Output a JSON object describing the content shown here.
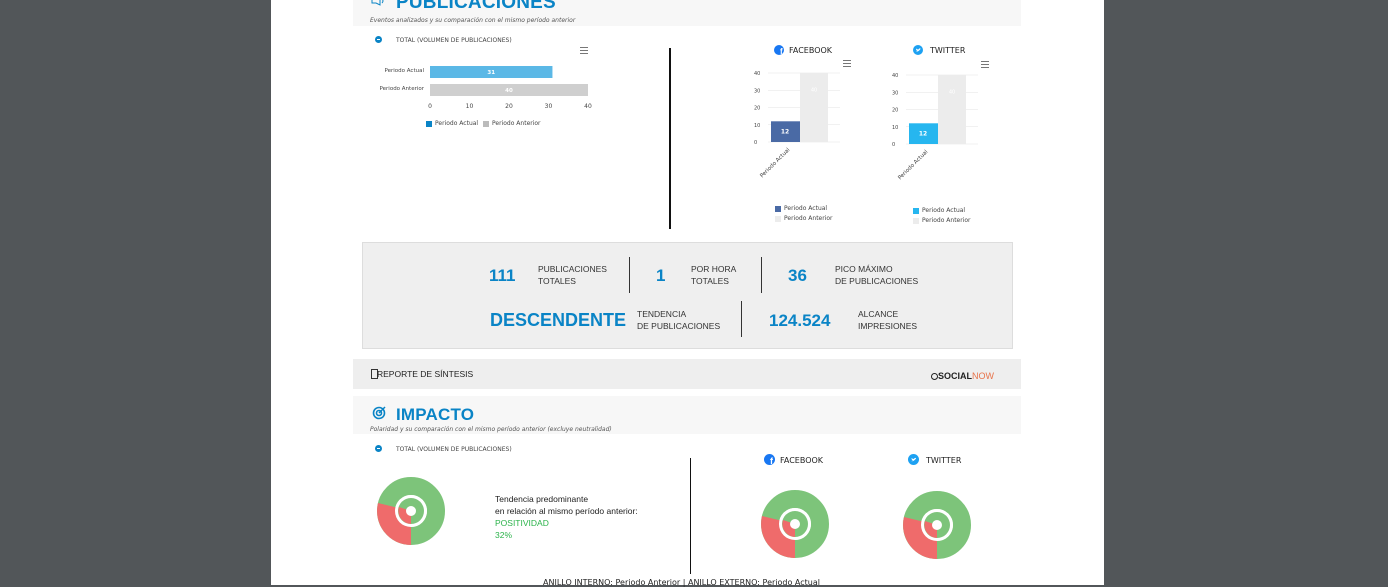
{
  "publicaciones": {
    "title": "PUBLICACIONES",
    "subtitle": "Eventos analizados y su comparación con el mismo período anterior",
    "total_label": "TOTAL (VOLUMEN DE PUBLICACIONES)",
    "facebook_label": "FACEBOOK",
    "twitter_label": "TWITTER",
    "legend_actual": "Periodo Actual",
    "legend_anterior": "Periodo Anterior"
  },
  "stats": {
    "publicaciones_totales": {
      "value": "111",
      "label1": "PUBLICACIONES",
      "label2": "TOTALES"
    },
    "por_hora": {
      "value": "1",
      "label1": "POR HORA",
      "label2": "TOTALES"
    },
    "pico": {
      "value": "36",
      "label1": "PICO MÁXIMO",
      "label2": "DE PUBLICACIONES"
    },
    "tendencia": {
      "value": "DESCENDENTE",
      "label1": "TENDENCIA",
      "label2": "DE PUBLICACIONES"
    },
    "alcance": {
      "value": "124.524",
      "label1": "ALCANCE",
      "label2": "IMPRESIONES"
    }
  },
  "footer": {
    "report_label": "REPORTE DE SÍNTESIS",
    "brand_bold": "SOCIAL",
    "brand_light": "NOW"
  },
  "impacto": {
    "title": "IMPACTO",
    "subtitle": "Polaridad y su comparación con el mismo período anterior (excluye neutralidad)",
    "total_label": "TOTAL (VOLUMEN DE PUBLICACIONES)",
    "facebook_label": "FACEBOOK",
    "twitter_label": "TWITTER",
    "trend_line1": "Tendencia predominante",
    "trend_line2": "en relación al mismo período anterior:",
    "trend_value": "POSITIVIDAD",
    "trend_pct": "32%",
    "bottom_caption": "ANILLO INTERNO: Periodo Anterior  |  ANILLO EXTERNO: Periodo Actual"
  },
  "chart_data": [
    {
      "type": "bar",
      "orientation": "horizontal",
      "categories": [
        "Periodo Actual",
        "Periodo Anterior"
      ],
      "values": [
        31,
        40
      ],
      "xlim": [
        0,
        40
      ],
      "xticks": [
        0,
        10,
        20,
        30,
        40
      ],
      "legend": [
        "Periodo Actual",
        "Periodo Anterior"
      ],
      "colors": [
        "#5bb8e6",
        "#cfcfcf"
      ]
    },
    {
      "type": "bar",
      "title": "FACEBOOK",
      "categories": [
        "Periodo Actual"
      ],
      "series": [
        {
          "name": "Periodo Actual",
          "values": [
            12
          ]
        },
        {
          "name": "Periodo Anterior",
          "values": [
            40
          ]
        }
      ],
      "ylim": [
        0,
        40
      ],
      "yticks": [
        0,
        10,
        20,
        30,
        40
      ],
      "colors": [
        "#4a6aa5",
        "#ececec"
      ]
    },
    {
      "type": "bar",
      "title": "TWITTER",
      "categories": [
        "Periodo Actual"
      ],
      "series": [
        {
          "name": "Periodo Actual",
          "values": [
            12
          ]
        },
        {
          "name": "Periodo Anterior",
          "values": [
            40
          ]
        }
      ],
      "ylim": [
        0,
        40
      ],
      "yticks": [
        0,
        10,
        20,
        30,
        40
      ],
      "colors": [
        "#26b6ef",
        "#ececec"
      ]
    }
  ],
  "colors": {
    "accent": "#0a84c6",
    "positive": "#7dc47a",
    "negative": "#ef6b6b",
    "trend_green": "#2bb34a"
  }
}
